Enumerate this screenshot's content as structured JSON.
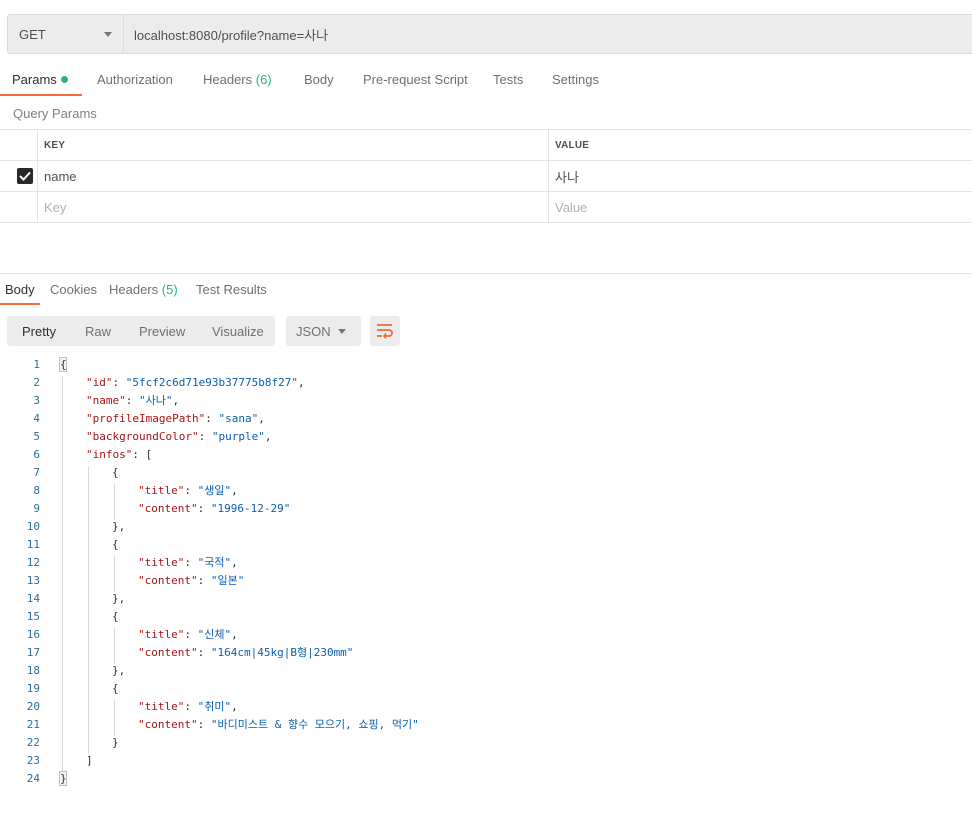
{
  "request": {
    "method": "GET",
    "url": "localhost:8080/profile?name=사나",
    "tabs": [
      {
        "label": "Params",
        "active": true,
        "indicator": "green-dot"
      },
      {
        "label": "Authorization"
      },
      {
        "label": "Headers",
        "count": "(6)"
      },
      {
        "label": "Body"
      },
      {
        "label": "Pre-request Script"
      },
      {
        "label": "Tests"
      },
      {
        "label": "Settings"
      }
    ],
    "query_params_title": "Query Params",
    "table": {
      "headers": {
        "key": "KEY",
        "value": "VALUE"
      },
      "rows": [
        {
          "checked": true,
          "key": "name",
          "value": "사나"
        }
      ],
      "placeholder": {
        "key": "Key",
        "value": "Value"
      }
    }
  },
  "response": {
    "tabs": [
      {
        "label": "Body",
        "active": true
      },
      {
        "label": "Cookies"
      },
      {
        "label": "Headers",
        "count": "(5)"
      },
      {
        "label": "Test Results"
      }
    ],
    "view_modes": [
      "Pretty",
      "Raw",
      "Preview",
      "Visualize"
    ],
    "active_view": "Pretty",
    "format": "JSON",
    "icons": {
      "wrap": "wrap-lines-icon",
      "dropdown": "chevron-down-icon",
      "check": "check-icon"
    },
    "colors": {
      "accent": "#f26b3a",
      "green": "#26b47f",
      "key": "#a31515",
      "string": "#0b5eb0",
      "line_number": "#2b6f9a"
    },
    "code_lines": [
      {
        "n": "1",
        "indent": 0,
        "parts": [
          {
            "t": "p",
            "v": "{"
          }
        ]
      },
      {
        "n": "2",
        "indent": 1,
        "parts": [
          {
            "t": "k",
            "v": "\"id\""
          },
          {
            "t": "p",
            "v": ": "
          },
          {
            "t": "s",
            "v": "\"5fcf2c6d71e93b37775b8f27\""
          },
          {
            "t": "p",
            "v": ","
          }
        ]
      },
      {
        "n": "3",
        "indent": 1,
        "parts": [
          {
            "t": "k",
            "v": "\"name\""
          },
          {
            "t": "p",
            "v": ": "
          },
          {
            "t": "s",
            "v": "\"사나\""
          },
          {
            "t": "p",
            "v": ","
          }
        ]
      },
      {
        "n": "4",
        "indent": 1,
        "parts": [
          {
            "t": "k",
            "v": "\"profileImagePath\""
          },
          {
            "t": "p",
            "v": ": "
          },
          {
            "t": "s",
            "v": "\"sana\""
          },
          {
            "t": "p",
            "v": ","
          }
        ]
      },
      {
        "n": "5",
        "indent": 1,
        "parts": [
          {
            "t": "k",
            "v": "\"backgroundColor\""
          },
          {
            "t": "p",
            "v": ": "
          },
          {
            "t": "s",
            "v": "\"purple\""
          },
          {
            "t": "p",
            "v": ","
          }
        ]
      },
      {
        "n": "6",
        "indent": 1,
        "parts": [
          {
            "t": "k",
            "v": "\"infos\""
          },
          {
            "t": "p",
            "v": ": ["
          }
        ]
      },
      {
        "n": "7",
        "indent": 2,
        "parts": [
          {
            "t": "p",
            "v": "{"
          }
        ]
      },
      {
        "n": "8",
        "indent": 3,
        "parts": [
          {
            "t": "k",
            "v": "\"title\""
          },
          {
            "t": "p",
            "v": ": "
          },
          {
            "t": "s",
            "v": "\"생일\""
          },
          {
            "t": "p",
            "v": ","
          }
        ]
      },
      {
        "n": "9",
        "indent": 3,
        "parts": [
          {
            "t": "k",
            "v": "\"content\""
          },
          {
            "t": "p",
            "v": ": "
          },
          {
            "t": "s",
            "v": "\"1996-12-29\""
          }
        ]
      },
      {
        "n": "10",
        "indent": 2,
        "parts": [
          {
            "t": "p",
            "v": "},"
          }
        ]
      },
      {
        "n": "11",
        "indent": 2,
        "parts": [
          {
            "t": "p",
            "v": "{"
          }
        ]
      },
      {
        "n": "12",
        "indent": 3,
        "parts": [
          {
            "t": "k",
            "v": "\"title\""
          },
          {
            "t": "p",
            "v": ": "
          },
          {
            "t": "s",
            "v": "\"국적\""
          },
          {
            "t": "p",
            "v": ","
          }
        ]
      },
      {
        "n": "13",
        "indent": 3,
        "parts": [
          {
            "t": "k",
            "v": "\"content\""
          },
          {
            "t": "p",
            "v": ": "
          },
          {
            "t": "s",
            "v": "\"일본\""
          }
        ]
      },
      {
        "n": "14",
        "indent": 2,
        "parts": [
          {
            "t": "p",
            "v": "},"
          }
        ]
      },
      {
        "n": "15",
        "indent": 2,
        "parts": [
          {
            "t": "p",
            "v": "{"
          }
        ]
      },
      {
        "n": "16",
        "indent": 3,
        "parts": [
          {
            "t": "k",
            "v": "\"title\""
          },
          {
            "t": "p",
            "v": ": "
          },
          {
            "t": "s",
            "v": "\"신체\""
          },
          {
            "t": "p",
            "v": ","
          }
        ]
      },
      {
        "n": "17",
        "indent": 3,
        "parts": [
          {
            "t": "k",
            "v": "\"content\""
          },
          {
            "t": "p",
            "v": ": "
          },
          {
            "t": "s",
            "v": "\"164cm|45kg|B형|230mm\""
          }
        ]
      },
      {
        "n": "18",
        "indent": 2,
        "parts": [
          {
            "t": "p",
            "v": "},"
          }
        ]
      },
      {
        "n": "19",
        "indent": 2,
        "parts": [
          {
            "t": "p",
            "v": "{"
          }
        ]
      },
      {
        "n": "20",
        "indent": 3,
        "parts": [
          {
            "t": "k",
            "v": "\"title\""
          },
          {
            "t": "p",
            "v": ": "
          },
          {
            "t": "s",
            "v": "\"취미\""
          },
          {
            "t": "p",
            "v": ","
          }
        ]
      },
      {
        "n": "21",
        "indent": 3,
        "parts": [
          {
            "t": "k",
            "v": "\"content\""
          },
          {
            "t": "p",
            "v": ": "
          },
          {
            "t": "s",
            "v": "\"바디미스트 & 향수 모으기, 쇼핑, 먹기\""
          }
        ]
      },
      {
        "n": "22",
        "indent": 2,
        "parts": [
          {
            "t": "p",
            "v": "}"
          }
        ]
      },
      {
        "n": "23",
        "indent": 1,
        "parts": [
          {
            "t": "p",
            "v": "]"
          }
        ]
      },
      {
        "n": "24",
        "indent": 0,
        "parts": [
          {
            "t": "p",
            "v": "}"
          }
        ]
      }
    ]
  }
}
